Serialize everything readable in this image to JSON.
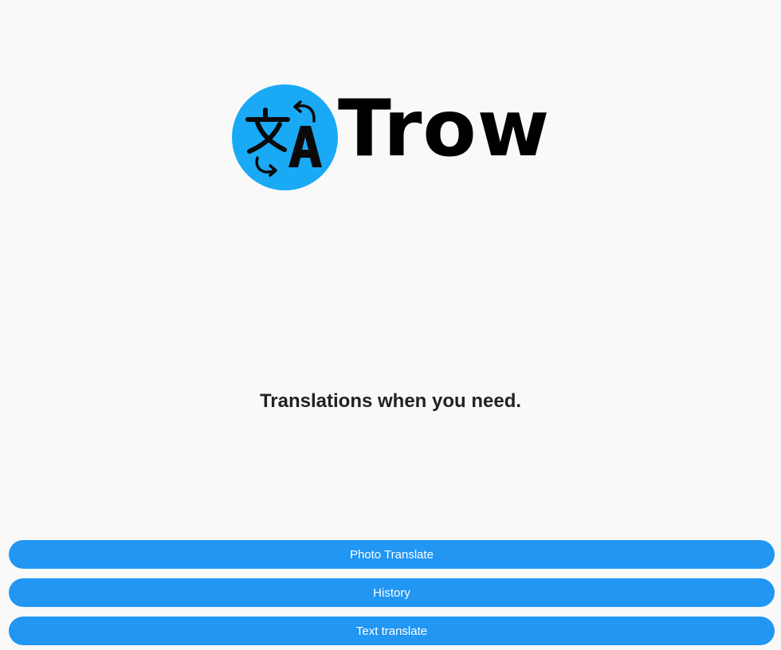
{
  "logo": {
    "icon": "translate-icon",
    "wordmark": "Trow",
    "badge_color": "#1aa9f5"
  },
  "tagline": "Translations when you need.",
  "buttons": {
    "photo_translate": "Photo Translate",
    "history": "History",
    "text_translate": "Text translate"
  },
  "colors": {
    "background": "#f9f9f9",
    "button": "#2196f3",
    "button_text": "#ffffff"
  }
}
